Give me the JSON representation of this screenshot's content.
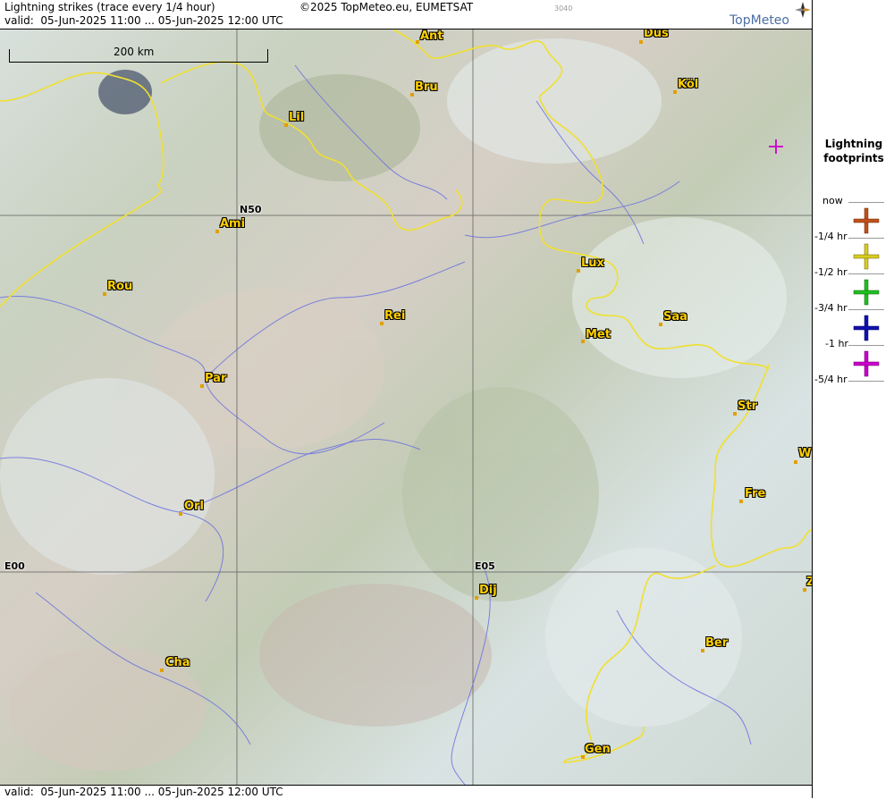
{
  "header": {
    "title": "Lightning strikes (trace every 1/4 hour)",
    "copyright": "©2025 TopMeteo.eu, EUMETSAT",
    "code": "3040",
    "valid": "valid:  05-Jun-2025 11:00 ... 05-Jun-2025 12:00 UTC",
    "logo": "TopMeteo"
  },
  "footer": {
    "valid": "valid:  05-Jun-2025 11:00 ... 05-Jun-2025 12:00 UTC"
  },
  "map": {
    "scale_label": "200 km",
    "grid_labels": [
      "N50",
      "E00",
      "E05"
    ],
    "cities": [
      "Ant",
      "Düs",
      "Bru",
      "Köl",
      "Lil",
      "Ami",
      "Rou",
      "Lux",
      "Rei",
      "Saa",
      "Met",
      "Par",
      "Str",
      "W",
      "Fre",
      "Orl",
      "Dij",
      "Ber",
      "Cha",
      "Gen",
      "Z"
    ],
    "strikes": [
      {
        "time_class": "-5/4 hr",
        "color": "#cc00cc"
      }
    ]
  },
  "legend": {
    "title_line1": "Lightning",
    "title_line2": "footprints",
    "items": [
      {
        "label": "now",
        "color": ""
      },
      {
        "label": "-1/4 hr",
        "color": "#c0501a"
      },
      {
        "label": "-1/2 hr",
        "color": "#d8cc20"
      },
      {
        "label": "-3/4 hr",
        "color": "#20c020"
      },
      {
        "label": "-1 hr",
        "color": "#1010b0"
      },
      {
        "label": "-5/4 hr",
        "color": "#cc00cc"
      }
    ]
  }
}
